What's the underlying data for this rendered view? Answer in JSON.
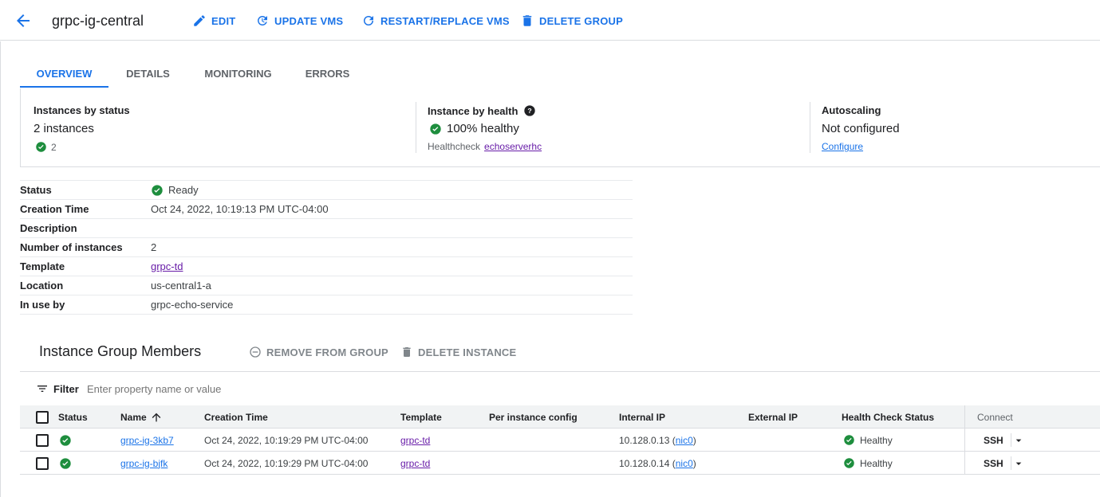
{
  "header": {
    "title": "grpc-ig-central",
    "actions": {
      "edit": "EDIT",
      "update_vms": "UPDATE VMS",
      "restart_replace": "RESTART/REPLACE VMS",
      "delete_group": "DELETE GROUP"
    }
  },
  "tabs": [
    {
      "label": "OVERVIEW",
      "active": true
    },
    {
      "label": "DETAILS",
      "active": false
    },
    {
      "label": "MONITORING",
      "active": false
    },
    {
      "label": "ERRORS",
      "active": false
    }
  ],
  "summary": {
    "status": {
      "heading": "Instances by status",
      "value": "2 instances",
      "ok_count": "2"
    },
    "health": {
      "heading": "Instance by health",
      "value": "100% healthy",
      "hc_label": "Healthcheck",
      "hc_link": "echoserverhc"
    },
    "autoscaling": {
      "heading": "Autoscaling",
      "value": "Not configured",
      "configure": "Configure"
    }
  },
  "details": {
    "status": {
      "label": "Status",
      "value": "Ready"
    },
    "creation_time": {
      "label": "Creation Time",
      "value": "Oct 24, 2022, 10:19:13 PM UTC-04:00"
    },
    "description": {
      "label": "Description",
      "value": ""
    },
    "num_instances": {
      "label": "Number of instances",
      "value": "2"
    },
    "template": {
      "label": "Template",
      "value": "grpc-td"
    },
    "location": {
      "label": "Location",
      "value": "us-central1-a"
    },
    "in_use_by": {
      "label": "In use by",
      "value": "grpc-echo-service"
    }
  },
  "members": {
    "title": "Instance Group Members",
    "remove_btn": "REMOVE FROM GROUP",
    "delete_btn": "DELETE INSTANCE",
    "filter_label": "Filter",
    "filter_placeholder": "Enter property name or value",
    "columns": {
      "status": "Status",
      "name": "Name",
      "creation_time": "Creation Time",
      "template": "Template",
      "per_instance": "Per instance config",
      "internal_ip": "Internal IP",
      "external_ip": "External IP",
      "health": "Health Check Status",
      "connect": "Connect"
    },
    "rows": [
      {
        "name": "grpc-ig-3kb7",
        "creation_time": "Oct 24, 2022, 10:19:29 PM UTC-04:00",
        "template": "grpc-td",
        "per_instance": "",
        "ip": "10.128.0.13",
        "nic_open": "(",
        "nic": "nic0",
        "nic_close": ")",
        "external_ip": "",
        "health": "Healthy",
        "connect": "SSH"
      },
      {
        "name": "grpc-ig-bjfk",
        "creation_time": "Oct 24, 2022, 10:19:29 PM UTC-04:00",
        "template": "grpc-td",
        "per_instance": "",
        "ip": "10.128.0.14",
        "nic_open": "(",
        "nic": "nic0",
        "nic_close": ")",
        "external_ip": "",
        "health": "Healthy",
        "connect": "SSH"
      }
    ]
  },
  "colors": {
    "accent": "#1a73e8",
    "ok_green": "#1e8e3e",
    "visited_link": "#681da8",
    "muted": "#80868b"
  }
}
